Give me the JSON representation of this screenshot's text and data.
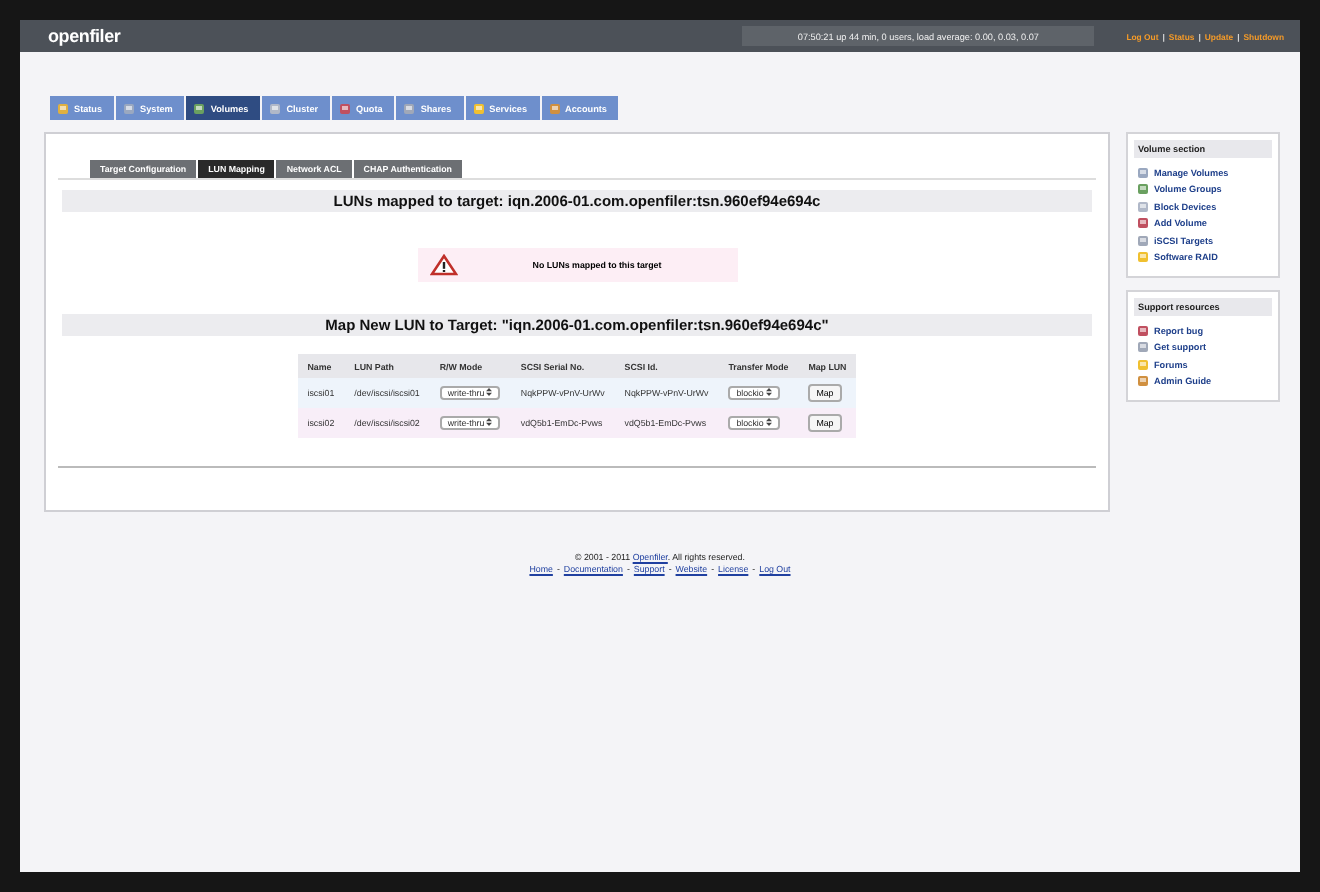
{
  "header": {
    "logo": "openfiler",
    "uptime": "07:50:21 up 44 min, 0 users, load average: 0.00, 0.03, 0.07",
    "links": [
      "Log Out",
      "Status",
      "Update",
      "Shutdown"
    ],
    "separator": "|"
  },
  "tabs": [
    {
      "label": "Status",
      "selected": false
    },
    {
      "label": "System",
      "selected": false
    },
    {
      "label": "Volumes",
      "selected": true
    },
    {
      "label": "Cluster",
      "selected": false
    },
    {
      "label": "Quota",
      "selected": false
    },
    {
      "label": "Shares",
      "selected": false
    },
    {
      "label": "Services",
      "selected": false
    },
    {
      "label": "Accounts",
      "selected": false
    }
  ],
  "subtabs": [
    {
      "label": "Target Configuration",
      "selected": false
    },
    {
      "label": "LUN Mapping",
      "selected": true
    },
    {
      "label": "Network ACL",
      "selected": false
    },
    {
      "label": "CHAP Authentication",
      "selected": false
    }
  ],
  "lun_heading": "LUNs mapped to target: iqn.2006-01.com.openfiler:tsn.960ef94e694c",
  "alert": "No LUNs mapped to this target",
  "map_heading": "Map New LUN to Target: \"iqn.2006-01.com.openfiler:tsn.960ef94e694c\"",
  "table": {
    "columns": [
      "Name",
      "LUN Path",
      "R/W Mode",
      "SCSI Serial No.",
      "SCSI Id.",
      "Transfer Mode",
      "Map LUN"
    ],
    "rows": [
      {
        "name": "iscsi01",
        "path": "/dev/iscsi/iscsi01",
        "rw_mode": "write-thru",
        "serial": "NqkPPW-vPnV-UrWv",
        "scsi_id": "NqkPPW-vPnV-UrWv",
        "transfer_mode": "blockio",
        "action": "Map"
      },
      {
        "name": "iscsi02",
        "path": "/dev/iscsi/iscsi02",
        "rw_mode": "write-thru",
        "serial": "vdQ5b1-EmDc-Pvws",
        "scsi_id": "vdQ5b1-EmDc-Pvws",
        "transfer_mode": "blockio",
        "action": "Map"
      }
    ]
  },
  "sidebar": [
    {
      "title": "Volume section",
      "items": [
        "Manage Volumes",
        "Volume Groups",
        "Block Devices",
        "Add Volume",
        "iSCSI Targets",
        "Software RAID"
      ]
    },
    {
      "title": "Support resources",
      "items": [
        "Report bug",
        "Get support",
        "Forums",
        "Admin Guide"
      ]
    }
  ],
  "footer": {
    "copyright": "© 2001 - 2011 ",
    "brand": "Openfiler",
    "rights": ". All rights reserved.",
    "links": [
      "Home",
      "Documentation",
      "Support",
      "Website",
      "License",
      "Log Out"
    ],
    "separator": "-"
  }
}
